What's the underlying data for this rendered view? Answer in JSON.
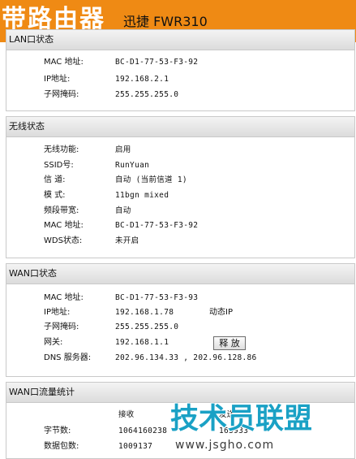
{
  "header": {
    "brand": "带路由器",
    "model": "迅捷 FWR310"
  },
  "lan": {
    "title": "LAN口状态",
    "rows": [
      {
        "label": "MAC 地址:",
        "value": "BC-D1-77-53-F3-92"
      },
      {
        "label": "IP地址:",
        "value": "192.168.2.1"
      },
      {
        "label": "子网掩码:",
        "value": "255.255.255.0"
      }
    ]
  },
  "wireless": {
    "title": "无线状态",
    "rows": [
      {
        "label": "无线功能:",
        "value": "启用"
      },
      {
        "label": "SSID号:",
        "value": "RunYuan"
      },
      {
        "label": "信  道:",
        "value": "自动 (当前信道 1)"
      },
      {
        "label": "模  式:",
        "value": "11bgn mixed"
      },
      {
        "label": "频段带宽:",
        "value": "自动"
      },
      {
        "label": "MAC 地址:",
        "value": "BC-D1-77-53-F3-92"
      },
      {
        "label": "WDS状态:",
        "value": "未开启"
      }
    ]
  },
  "wan": {
    "title": "WAN口状态",
    "rows": [
      {
        "label": "MAC 地址:",
        "value": "BC-D1-77-53-F3-93"
      },
      {
        "label": "IP地址:",
        "value": "192.168.1.78",
        "extra": "动态IP"
      },
      {
        "label": "子网掩码:",
        "value": "255.255.255.0"
      },
      {
        "label": "网关:",
        "value": "192.168.1.1"
      },
      {
        "label": "DNS 服务器:",
        "value": "202.96.134.33 , 202.96.128.86"
      }
    ],
    "release_button": "释 放"
  },
  "traffic": {
    "title": "WAN口流量统计",
    "col_receive": "接收",
    "col_send": "发送",
    "rows": [
      {
        "label": "字节数:",
        "receive": "1064160238",
        "send": "163933"
      },
      {
        "label": "数据包数:",
        "receive": "1009137",
        "send": ""
      }
    ]
  },
  "watermark": {
    "cn": "技术员联盟",
    "url": "www.jsgho.com"
  }
}
